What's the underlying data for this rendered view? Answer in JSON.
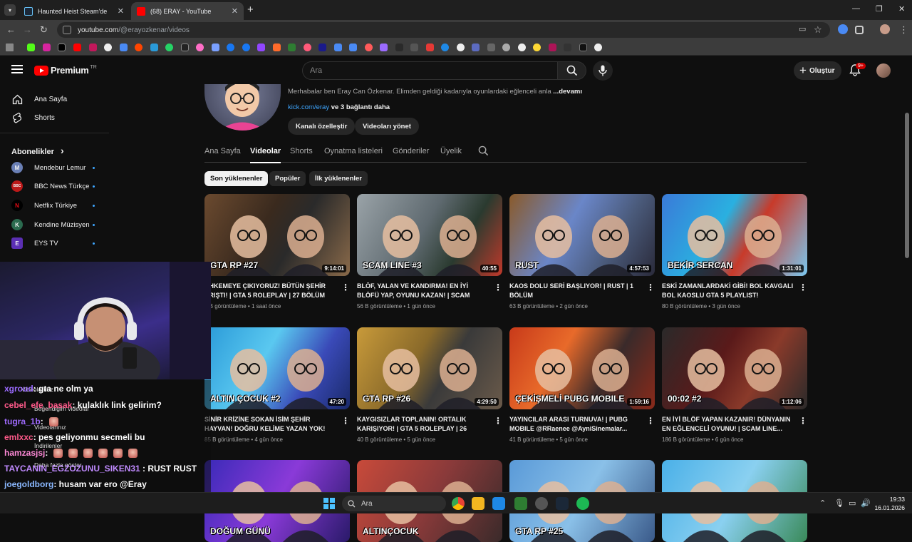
{
  "browser": {
    "tabs": [
      {
        "title": "Haunted Heist Steam'de",
        "color": "#1b2838"
      },
      {
        "title": "(68) ERAY - YouTube",
        "color": "#ff0000"
      }
    ],
    "url": {
      "host": "youtube.com",
      "path": "/@erayozkenar/videos"
    }
  },
  "youtube": {
    "logo_text": "Premium",
    "region": "TR",
    "search_placeholder": "Ara",
    "create_label": "Oluştur",
    "notifications": "9+"
  },
  "guide": {
    "items": [
      {
        "label": "Ana Sayfa",
        "icon": "home-icon"
      },
      {
        "label": "Shorts",
        "icon": "shorts-icon"
      }
    ],
    "subs_heading": "Abonelikler",
    "subs_chevron": "›",
    "subs": [
      {
        "name": "Mendebur Lemur",
        "color": "#6a7fb5",
        "glyph": "M"
      },
      {
        "name": "BBC News Türkçe",
        "color": "#bb1919",
        "glyph": "BBC"
      },
      {
        "name": "Netflix Türkiye",
        "color": "#000000",
        "glyph": "N"
      },
      {
        "name": "Kendine Müzisyen",
        "color": "#2b6b4f",
        "glyph": "K"
      },
      {
        "name": "EYS TV",
        "color": "#5b2fb3",
        "glyph": "E"
      }
    ]
  },
  "channel": {
    "description": "Merhabalar ben Eray Can Özkenar. Elimden geldiği kadarıyla oyunlardaki eğlenceli anla",
    "more": "...devamı",
    "link": "kick.com/eray",
    "link_more": " ve 3 bağlantı daha",
    "buttons": [
      "Kanalı özelleştir",
      "Videoları yönet"
    ],
    "tabs": [
      "Ana Sayfa",
      "Videolar",
      "Shorts",
      "Oynatma listeleri",
      "Gönderiler",
      "Üyelik"
    ],
    "chips": [
      "Son yüklenenler",
      "Popüler",
      "İlk yüklenenler"
    ]
  },
  "videos": [
    {
      "title": "AHKEMEYE ÇIKIYORUZ! BÜTÜN ŞEHİR ARIŞTI! | GTA 5 ROLEPLAY | 27 BÖLÜM",
      "views": "7 B görüntüleme",
      "age": "1 saat önce",
      "duration": "9:14:01",
      "overlay": "GTA RP #27",
      "bg": "linear-gradient(120deg,#6b4a2f,#3a2a1e 40%,#2a2a2a 60%,#8a6a4a)"
    },
    {
      "title": "BLÖF, YALAN VE KANDIRMA! EN İYİ BLÖFÜ YAP, OYUNU KAZAN! | SCAM LINE...",
      "views": "56 B görüntüleme",
      "age": "1 gün önce",
      "duration": "40:55",
      "overlay": "SCAM LINE #3",
      "bg": "linear-gradient(120deg,#9aa3a8,#5f6a70 45%,#2a3a2f 70%,#c0392b)"
    },
    {
      "title": "KAOS DOLU SERİ BAŞLIYOR! | RUST | 1 BÖLÜM",
      "views": "63 B görüntüleme",
      "age": "2 gün önce",
      "duration": "4:57:53",
      "overlay": "RUST",
      "bg": "linear-gradient(120deg,#8a5a2a,#6a86c8 40%,#4a5a7a 70%,#2a2a3a)"
    },
    {
      "title": "ESKİ ZAMANLARDAKİ GİBİ! BOL KAVGALI BOL KAOSLU GTA 5 PLAYLIST!",
      "views": "80 B görüntüleme",
      "age": "3 gün önce",
      "duration": "1:31:01",
      "overlay": "BEKİR SERCAN",
      "bg": "linear-gradient(120deg,#3a7ad8,#2ab0e0 40%,#c83a2a 60%,#7ac8f0)"
    },
    {
      "title": "SİNİR KRİZİNE SOKAN İSİM ŞEHİR HAYVAN! DOĞRU KELİME YAZAN YOK!",
      "views": "85 B görüntüleme",
      "age": "4 gün önce",
      "duration": "47:20",
      "overlay": "ALTIN ÇOCUK #2",
      "bg": "linear-gradient(120deg,#2a9ad8,#5ac8f0 40%,#3a4ab8 70%,#1a2a6a)"
    },
    {
      "title": "KAYGISIZLAR TOPLANIN! ORTALIK KARIŞIYOR! | GTA 5 ROLEPLAY | 26 BÖLÜM",
      "views": "40 B görüntüleme",
      "age": "5 gün önce",
      "duration": "4:29:50",
      "overlay": "GTA RP #26",
      "bg": "linear-gradient(120deg,#c89a3a,#8a6a2a 40%,#3a3a3a 60%,#6a5a4a)"
    },
    {
      "title": "YAYINCILAR ARASI TURNUVA! | PUBG MOBILE @RRaenee @AyniSinemalar...",
      "views": "41 B görüntüleme",
      "age": "5 gün önce",
      "duration": "1:59:16",
      "overlay": "ÇEKİŞMELİ PUBG MOBILE",
      "bg": "linear-gradient(120deg,#c83a1a,#e86a2a 35%,#3a2a2a 65%,#8a2a1a)"
    },
    {
      "title": "EN İYİ BLÖF YAPAN KAZANIR! DÜNYANIN EN EĞLENCELİ OYUNU! | SCAM LINE...",
      "views": "186 B görüntüleme",
      "age": "6 gün önce",
      "duration": "1:12:06",
      "overlay": "00:02 #2",
      "bg": "linear-gradient(120deg,#2a2a2a,#5a1a1a 40%,#8a3a2a 65%,#2a2a2a)"
    },
    {
      "title": "",
      "views": "",
      "age": "",
      "duration": "",
      "overlay": "DOĞUM GÜNÜ",
      "bg": "linear-gradient(120deg,#3a2ab8,#8a3ad8 50%,#2a1a6a)"
    },
    {
      "title": "",
      "views": "",
      "age": "",
      "duration": "",
      "overlay": "ALTINÇOCUK",
      "bg": "linear-gradient(120deg,#c84a3a,#8a3a3a 50%,#3a2a2a)"
    },
    {
      "title": "",
      "views": "",
      "age": "",
      "duration": "",
      "overlay": "GTA RP #25",
      "bg": "linear-gradient(120deg,#5a9ad8,#8ac0e8 50%,#3a5a8a)"
    },
    {
      "title": "",
      "views": "",
      "age": "",
      "duration": "",
      "overlay": "",
      "bg": "linear-gradient(120deg,#4ab0e8,#8ad0f0 50%,#3a8a5a)"
    }
  ],
  "chat": [
    {
      "user": "xgroud",
      "msg": ": gta ne olm ya",
      "color": "#9b6bff"
    },
    {
      "user": "cebel_efe_basak",
      "msg": ": kulaklık link gelirim?",
      "color": "#ff5a8a"
    },
    {
      "user": "tugra_1b",
      "msg": ":",
      "color": "#a06bff"
    },
    {
      "user": "emlxxc",
      "msg": ": pes geliyonmu secmeli bu",
      "color": "#ff5a8a"
    },
    {
      "user": "hamzasjsj",
      "msg": ":",
      "color": "#ff8ad8"
    },
    {
      "user": "TAYCANIN_EGZOZUNU_SIKEN31",
      "msg": " : RUST RUST",
      "color": "#c08aff"
    },
    {
      "user": "joegoldborg",
      "msg": ": husam var ero @Eray",
      "color": "#8ab8ff"
    }
  ],
  "chat_under": [
    "Videolarınız",
    "Beğendiğim videolar",
    "Videolarınız",
    "İndirilenler",
    "Daha fazla göster"
  ],
  "taskbar": {
    "search": "Ara",
    "time": "19:33",
    "date": "16.01.2026"
  }
}
